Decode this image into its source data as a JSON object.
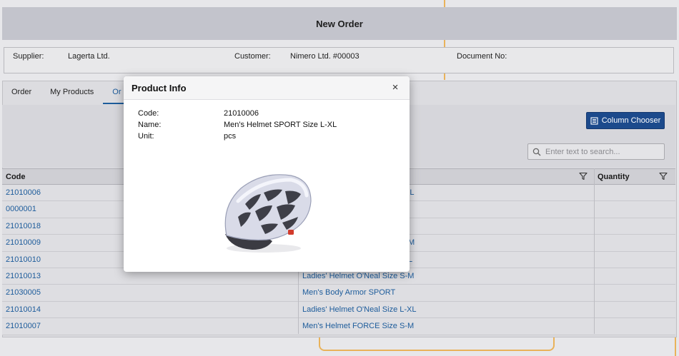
{
  "header": {
    "title": "New Order"
  },
  "info": {
    "supplier_label": "Supplier:",
    "supplier_value": "Lagerta Ltd.",
    "customer_label": "Customer:",
    "customer_value": "Nimero Ltd. #00003",
    "document_label": "Document No:"
  },
  "tabs": [
    {
      "label": "Order"
    },
    {
      "label": "My Products"
    },
    {
      "label": "Or"
    }
  ],
  "toolbar": {
    "column_chooser_label": "Column Chooser",
    "search_placeholder": "Enter text to search..."
  },
  "grid": {
    "headers": {
      "code": "Code",
      "quantity": "Quantity"
    },
    "rows": [
      {
        "code": "21010006",
        "name": "XL"
      },
      {
        "code": "0000001",
        "name": ""
      },
      {
        "code": "21010018",
        "name": ""
      },
      {
        "code": "21010009",
        "name": "M"
      },
      {
        "code": "21010010",
        "name": "L"
      },
      {
        "code": "21010013",
        "name": "Ladies' Helmet O'Neal Size S-M"
      },
      {
        "code": "21030005",
        "name": "Men's Body Armor SPORT"
      },
      {
        "code": "21010014",
        "name": "Ladies' Helmet O'Neal Size L-XL"
      },
      {
        "code": "21010007",
        "name": "Men's Helmet FORCE Size S-M"
      }
    ]
  },
  "modal": {
    "title": "Product Info",
    "close": "×",
    "code_label": "Code:",
    "code_value": "21010006",
    "name_label": "Name:",
    "name_value": "Men's Helmet SPORT Size L-XL",
    "unit_label": "Unit:",
    "unit_value": "pcs"
  },
  "icons": {
    "close": "close-icon",
    "column_chooser": "columns-icon",
    "search": "search-icon",
    "filter": "filter-icon"
  },
  "colors": {
    "accent": "#1c4a8c",
    "link": "#1d5c9b",
    "decor": "#e9b25a"
  }
}
